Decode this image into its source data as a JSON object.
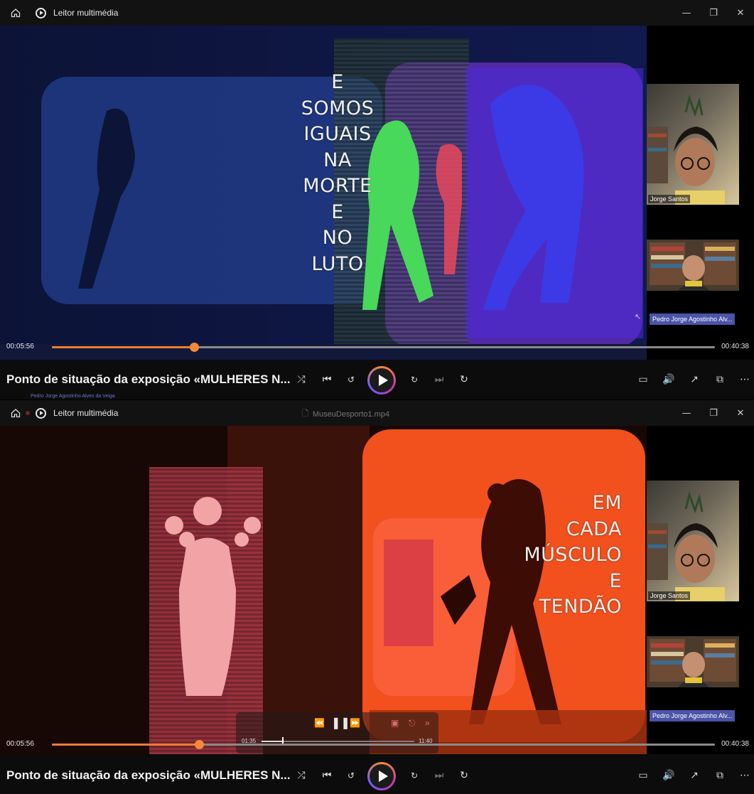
{
  "windows": [
    {
      "app_title": "Leitor multimédia",
      "filename": "",
      "video_poem": [
        "E",
        "SOMOS",
        "IGUAIS",
        "NA",
        "MORTE",
        "E",
        "NO",
        "LUTO"
      ],
      "participants": [
        {
          "name": "Jorge Santos"
        },
        {
          "name": "Pedro Jorge Agostinho Alv..."
        }
      ],
      "time_current": "00:05:56",
      "time_total": "00:40:38",
      "progress": 0.214,
      "media_title": "Ponto de situação da exposição «MULHERES N...",
      "underlay_caption": "Pedro Jorge Agostinho Alves da Veiga"
    },
    {
      "app_title": "Leitor multimédia",
      "filename": "MuseuDesporto1.mp4",
      "video_poem": [
        "EM",
        "CADA",
        "MÚSCULO",
        "E",
        "TENDÃO"
      ],
      "participants": [
        {
          "name": "Jorge Santos"
        },
        {
          "name": "Pedro Jorge Agostinho Alv..."
        }
      ],
      "time_current": "00:05:56",
      "time_total": "00:40:38",
      "progress": 0.222,
      "media_title": "Ponto de situação da exposição «MULHERES N...",
      "mini_player": {
        "time_current": "01:35",
        "time_total": "11:40",
        "progress": 0.136
      }
    }
  ],
  "icons": {
    "home": "home-icon",
    "shuffle": "shuffle-icon",
    "previous": "previous-icon",
    "rewind10": "rewind-10-icon",
    "play": "play-icon",
    "forward30": "forward-30-icon",
    "next": "next-icon",
    "repeat": "repeat-off-icon",
    "subtitles": "subtitles-icon",
    "volume": "volume-icon",
    "fullscreen": "fullscreen-icon",
    "miniplayer": "mini-player-icon",
    "more": "more-icon"
  },
  "colors": {
    "accent": "#f07d2e",
    "chip": "#4b54a8"
  }
}
